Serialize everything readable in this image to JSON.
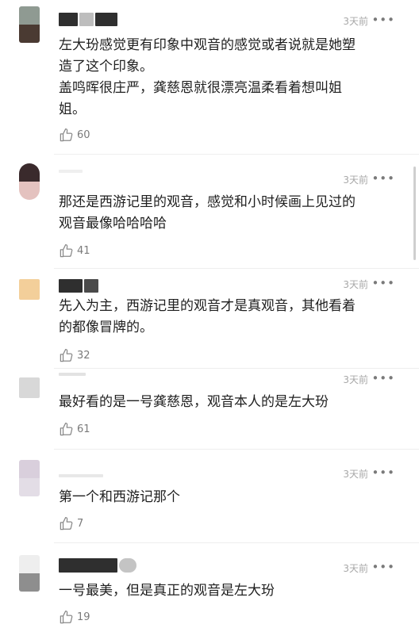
{
  "comments": [
    {
      "time": "3天前",
      "more": "•••",
      "text_lines": [
        "左大玢感觉更有印象中观音的感觉或者说就是她塑",
        "造了这个印象。",
        "盖鸣晖很庄严，龚慈恩就很漂亮温柔看着想叫姐",
        "姐。"
      ],
      "likes": "60"
    },
    {
      "time": "3天前",
      "more": "•••",
      "text_lines": [
        "那还是西游记里的观音，感觉和小时候画上见过的",
        "观音最像哈哈哈哈"
      ],
      "likes": "41"
    },
    {
      "time": "3天前",
      "more": "•••",
      "text_lines": [
        "先入为主，西游记里的观音才是真观音，其他看着",
        "的都像冒牌的。"
      ],
      "likes": "32"
    },
    {
      "time": "3天前",
      "more": "•••",
      "text_lines": [
        "最好看的是一号龚慈恩，观音本人的是左大玢"
      ],
      "likes": "61"
    },
    {
      "time": "3天前",
      "more": "•••",
      "text_lines": [
        "第一个和西游记那个"
      ],
      "likes": "7"
    },
    {
      "time": "3天前",
      "more": "•••",
      "text_lines": [
        "一号最美，但是真正的观音是左大玢"
      ],
      "likes": "19"
    }
  ],
  "colors": {
    "avatar_1_top": "#8f9a92",
    "avatar_1_bottom": "#4a3a32",
    "avatar_2_top": "#3a2a2c",
    "avatar_2_bottom": "#e4c2bf",
    "avatar_3": "#f3cf9a",
    "avatar_4": "#d8d8d8",
    "avatar_5_top": "#d9cfdc",
    "avatar_5_bottom": "#e3dde6",
    "avatar_6_top": "#eeeeee",
    "avatar_6_bottom": "#8e8e8e",
    "name_redaction": "#2f2f2f",
    "time_text": "#a8a8a8",
    "like_icon": "#8a8a8a"
  }
}
